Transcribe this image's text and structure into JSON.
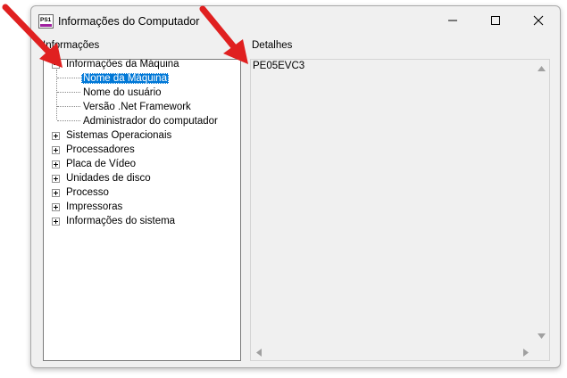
{
  "window": {
    "title": "Informações do Computador",
    "app_icon": "ps1-script-icon"
  },
  "labels": {
    "tree_section": "Informações",
    "detail_section": "Detalhes"
  },
  "tree": {
    "root": {
      "label": "Informações da Máquina",
      "expanded": true,
      "children": [
        {
          "label": "Nome da Máquina",
          "selected": true
        },
        {
          "label": "Nome do usuário"
        },
        {
          "label": "Versão .Net Framework"
        },
        {
          "label": "Administrador do computador"
        }
      ]
    },
    "collapsed_items": [
      {
        "label": "Sistemas Operacionais"
      },
      {
        "label": "Processadores"
      },
      {
        "label": "Placa de Vídeo"
      },
      {
        "label": "Unidades de disco"
      },
      {
        "label": "Processo"
      },
      {
        "label": "Impressoras"
      },
      {
        "label": "Informações do sistema"
      }
    ]
  },
  "details": {
    "value": "PE05EVC3"
  },
  "colors": {
    "selection": "#0078d7",
    "annotation_arrow": "#e02020"
  }
}
